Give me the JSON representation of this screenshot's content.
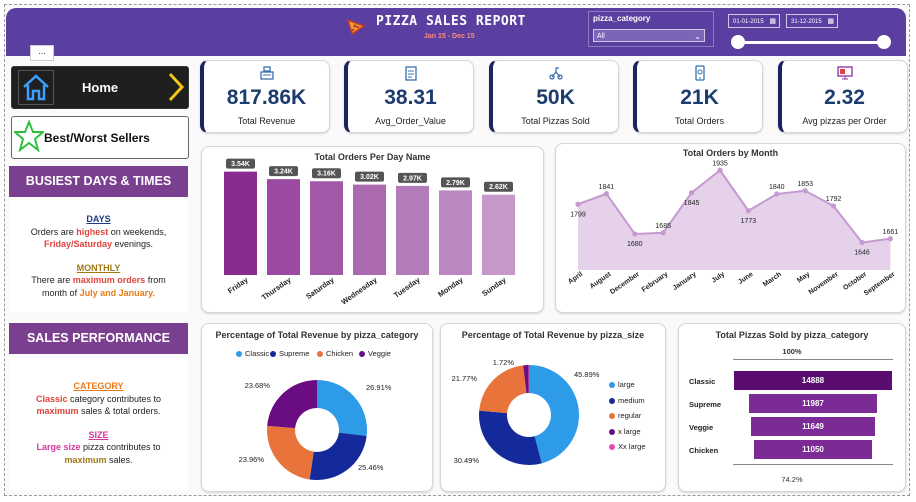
{
  "header": {
    "title": "PIZZA SALES REPORT",
    "subtitle": "Jan 15 - Dec 15",
    "slicer_label": "pizza_category",
    "slicer_value": "All",
    "date_start": "01-01-2015",
    "date_end": "31-12-2015",
    "range_value": [
      0,
      1
    ]
  },
  "nav": {
    "dots": "...",
    "home_label": "Home",
    "best_label": "Best/Worst Sellers"
  },
  "busiest": {
    "heading": "BUSIEST DAYS & TIMES",
    "days_title": "DAYS",
    "days_line1_a": "Orders are ",
    "days_line1_b": "highest",
    "days_line1_c": " on weekends,",
    "days_line2_a": "Friday/Saturday",
    "days_line2_b": " evenings.",
    "monthly_title": "MONTHLY",
    "monthly_line1_a": "There are ",
    "monthly_line1_b": "maximum orders",
    "monthly_line1_c": " from",
    "monthly_line2_a": "month of ",
    "monthly_line2_b": "July and January."
  },
  "sales": {
    "heading": "SALES PERFORMANCE",
    "category_title": "CATEGORY",
    "cat_line1_a": "Classic",
    "cat_line1_b": " category contributes to",
    "cat_line2_a": "maximum",
    "cat_line2_b": " sales & total orders.",
    "size_title": "SIZE",
    "size_line1_a": "Large size",
    "size_line1_b": " pizza contributes to",
    "size_line2": "maximum",
    "size_line2_b": " sales."
  },
  "kpis": [
    {
      "value": "817.86K",
      "label": "Total Revenue",
      "icon": "cash-register-icon"
    },
    {
      "value": "38.31",
      "label": "Avg_Order_Value",
      "icon": "clipboard-icon"
    },
    {
      "value": "50K",
      "label": "Total Pizzas Sold",
      "icon": "delivery-icon"
    },
    {
      "value": "21K",
      "label": "Total Orders",
      "icon": "mobile-order-icon"
    },
    {
      "value": "2.32",
      "label": "Avg pizzas per Order",
      "icon": "monitor-icon"
    }
  ],
  "colors": {
    "header": "#5b3fa0",
    "section": "#7b3f8f",
    "kpi_value": "#1c3b6e",
    "classic": "#2e9be8",
    "supreme": "#14299a",
    "chicken": "#e8743b",
    "veggie": "#6a0d83",
    "funnel": "#7b2a96"
  },
  "chart_data": [
    {
      "type": "bar",
      "title": "Total Orders Per Day Name",
      "categories": [
        "Friday",
        "Thursday",
        "Saturday",
        "Wednesday",
        "Tuesday",
        "Monday",
        "Sunday"
      ],
      "values": [
        3538,
        3239,
        3158,
        3024,
        2973,
        2794,
        2624
      ],
      "labels": [
        "3.54K",
        "3.24K",
        "3.16K",
        "3.02K",
        "2.97K",
        "2.79K",
        "2.62K"
      ],
      "colors": [
        "#8a2c8f",
        "#9a4aa0",
        "#a25aa8",
        "#ab6ab0",
        "#b47bb9",
        "#bb87c0",
        "#c598c9"
      ],
      "ylim": [
        0,
        3800
      ]
    },
    {
      "type": "area",
      "title": "Total Orders by Month",
      "categories": [
        "April",
        "August",
        "December",
        "February",
        "January",
        "July",
        "June",
        "March",
        "May",
        "November",
        "October",
        "September"
      ],
      "values": [
        1799,
        1841,
        1680,
        1685,
        1845,
        1935,
        1773,
        1840,
        1853,
        1792,
        1646,
        1661
      ],
      "ylim": [
        1600,
        1960
      ],
      "color": "#c49ad0"
    },
    {
      "type": "pie",
      "title": "Percentage of Total Revenue by pizza_category",
      "legend": [
        "Classic",
        "Supreme",
        "Chicken",
        "Veggie"
      ],
      "values": [
        26.91,
        25.46,
        23.96,
        23.68
      ],
      "labels": [
        "26.91%",
        "25.46%",
        "23.96%",
        "23.68%"
      ],
      "colors": [
        "#2e9be8",
        "#14299a",
        "#e8743b",
        "#6a0d83"
      ]
    },
    {
      "type": "pie",
      "title": "Percentage of Total Revenue by pizza_size",
      "legend": [
        "large",
        "medium",
        "regular",
        "x large",
        "Xx large"
      ],
      "values": [
        45.89,
        30.49,
        21.77,
        1.72,
        0.12
      ],
      "labels": [
        "45.89%",
        "30.49%",
        "21.77%",
        "1.72%",
        ""
      ],
      "colors": [
        "#2e9be8",
        "#14299a",
        "#e8743b",
        "#6a0d83",
        "#e64ab0"
      ]
    },
    {
      "type": "bar",
      "title": "Total Pizzas Sold by pizza_category",
      "categories": [
        "Classic",
        "Supreme",
        "Veggie",
        "Chicken"
      ],
      "values": [
        14888,
        11987,
        11649,
        11050
      ],
      "top_label": "100%",
      "bottom_label": "74.2%",
      "colors": [
        "#5b0d6f",
        "#7b2a96",
        "#7b2a96",
        "#7b2a96"
      ]
    }
  ]
}
